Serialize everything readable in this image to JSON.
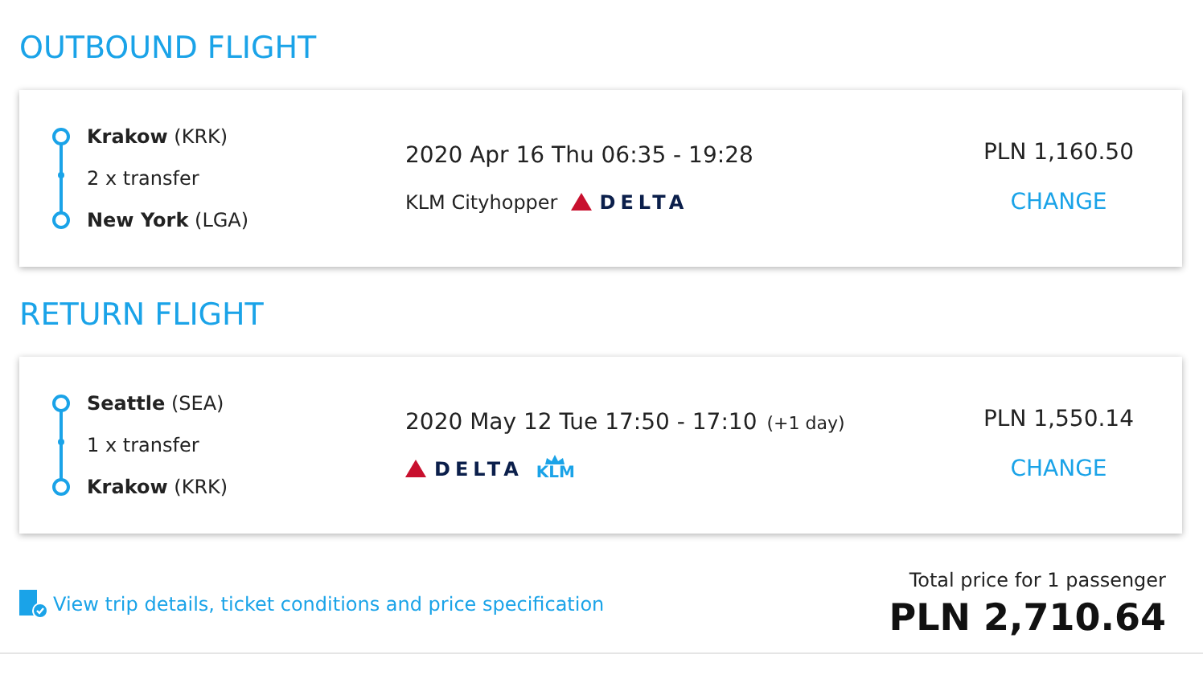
{
  "flights": [
    {
      "heading": "OUTBOUND FLIGHT",
      "from": {
        "city": "Krakow",
        "code": "(KRK)"
      },
      "transfers": "2 x transfer",
      "to": {
        "city": "New York",
        "code": "(LGA)"
      },
      "schedule": "2020 Apr 16 Thu 06:35 - 19:28",
      "carriers": [
        {
          "kind": "text",
          "label": "KLM Cityhopper"
        },
        {
          "kind": "delta",
          "label": "DELTA"
        }
      ],
      "price": "PLN 1,160.50",
      "action": "CHANGE"
    },
    {
      "heading": "RETURN FLIGHT",
      "from": {
        "city": "Seattle",
        "code": "(SEA)"
      },
      "transfers": "1 x transfer",
      "to": {
        "city": "Krakow",
        "code": "(KRK)"
      },
      "schedule": "2020 May 12 Tue 17:50 - 17:10",
      "schedule_note": "(+1 day)",
      "carriers": [
        {
          "kind": "delta",
          "label": "DELTA"
        },
        {
          "kind": "klm",
          "label": "KLM"
        }
      ],
      "price": "PLN 1,550.14",
      "action": "CHANGE"
    }
  ],
  "footer": {
    "link": "View trip details, ticket conditions and price specification",
    "total_label": "Total price for 1 passenger",
    "total": "PLN 2,710.64"
  }
}
